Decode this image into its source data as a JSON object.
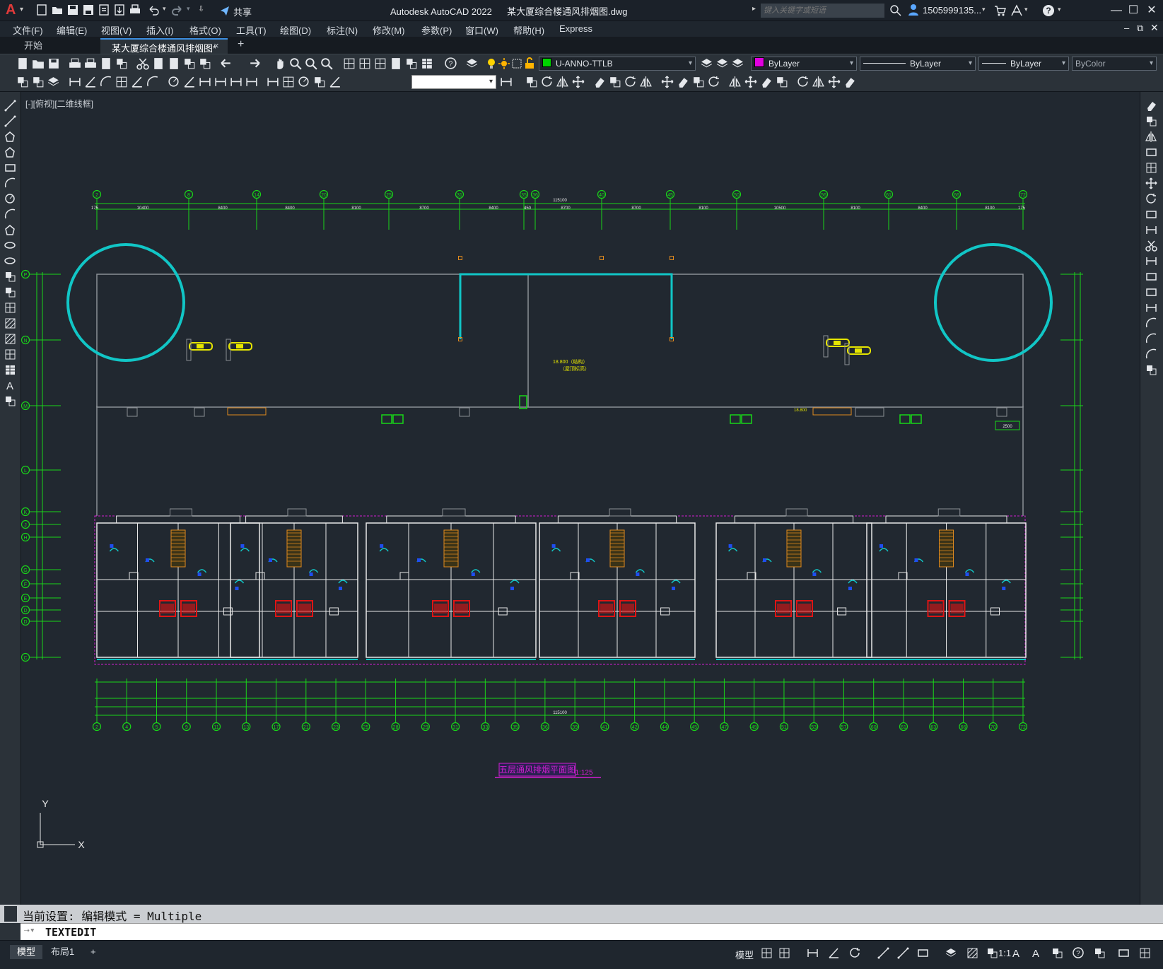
{
  "app": {
    "logo": "A",
    "title": "Autodesk AutoCAD 2022",
    "filename": "某大厦综合楼通风排烟图.dwg",
    "share_label": "共享",
    "search_placeholder": "键入关键字或短语",
    "user": "1505999135...",
    "accent_red": "#e03a3a"
  },
  "menu": {
    "items": [
      "文件(F)",
      "编辑(E)",
      "视图(V)",
      "插入(I)",
      "格式(O)",
      "工具(T)",
      "绘图(D)",
      "标注(N)",
      "修改(M)",
      "参数(P)",
      "窗口(W)",
      "帮助(H)",
      "Express"
    ]
  },
  "tabs": {
    "start": "开始",
    "active": "某大厦综合楼通风排烟图*",
    "close": "×",
    "add": "+"
  },
  "properties": {
    "layer": "U-ANNO-TTLB",
    "layer_color": "#00d400",
    "color": "ByLayer",
    "color_swatch": "#e000e0",
    "linetype": "ByLayer",
    "lineweight": "ByLayer",
    "plotstyle": "ByColor"
  },
  "viewport": {
    "label": "[-][俯视][二维线框]"
  },
  "drawing": {
    "top_axis_labels": [
      "2",
      "8",
      "14",
      "20",
      "25",
      "31",
      "35",
      "36",
      "40",
      "45",
      "50",
      "56",
      "61",
      "66",
      "72"
    ],
    "top_dims": [
      "175",
      "10400",
      "8400",
      "8400",
      "8100",
      "8700",
      "8400",
      "450",
      "8700",
      "8700",
      "8100",
      "10500",
      "8100",
      "8400",
      "8100",
      "175"
    ],
    "top_total": "115100",
    "bottom_axis_labels": [
      "2",
      "4",
      "5",
      "9",
      "11",
      "13",
      "17",
      "21",
      "23",
      "25",
      "28",
      "29",
      "31",
      "33",
      "35",
      "36",
      "39",
      "41",
      "42",
      "44",
      "45",
      "47",
      "49",
      "51",
      "53",
      "57",
      "60",
      "61",
      "63",
      "66",
      "70",
      "72"
    ],
    "bottom_total": "115100",
    "left_axis_labels": [
      "P",
      "N",
      "M",
      "L",
      "K",
      "J",
      "H",
      "G",
      "F",
      "E",
      "D",
      "D",
      "C"
    ],
    "right_note": "2500",
    "annotation_1": "18.800（结构）",
    "annotation_2": "（屋顶标高）",
    "annotation_3": "18.800",
    "title_label": "五层通风排烟平面图",
    "title_scale": "1:125",
    "ucs_x": "X",
    "ucs_y": "Y",
    "colors": {
      "green": "#19d619",
      "cyan": "#11c6c6",
      "yellow": "#e6e600",
      "magenta": "#d21ed2",
      "red": "#e01414",
      "white": "#e8e8e8",
      "grey": "#8a8f95",
      "orange": "#e08a1e"
    }
  },
  "command": {
    "history": "当前设置: 编辑模式 = Multiple",
    "current": "TEXTEDIT"
  },
  "status": {
    "tab_model": "模型",
    "tab_layout": "布局1",
    "add": "+",
    "model_button": "模型",
    "scale": "1:1"
  }
}
